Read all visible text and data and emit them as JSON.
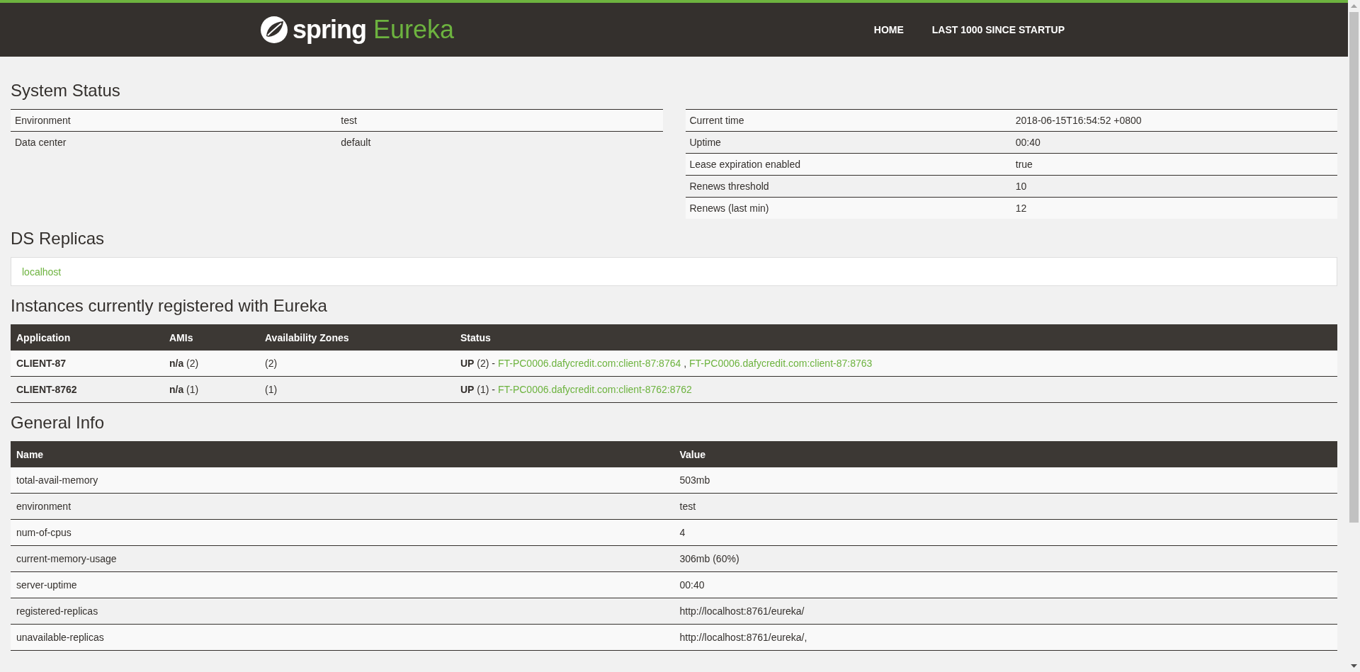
{
  "header": {
    "brand": "spring",
    "product": "Eureka",
    "nav": [
      {
        "label": "HOME"
      },
      {
        "label": "LAST 1000 SINCE STARTUP"
      }
    ]
  },
  "system_status": {
    "title": "System Status",
    "left": [
      {
        "label": "Environment",
        "value": "test"
      },
      {
        "label": "Data center",
        "value": "default"
      }
    ],
    "right": [
      {
        "label": "Current time",
        "value": "2018-06-15T16:54:52 +0800"
      },
      {
        "label": "Uptime",
        "value": "00:40"
      },
      {
        "label": "Lease expiration enabled",
        "value": "true"
      },
      {
        "label": "Renews threshold",
        "value": "10"
      },
      {
        "label": "Renews (last min)",
        "value": "12"
      }
    ]
  },
  "ds_replicas": {
    "title": "DS Replicas",
    "items": [
      "localhost"
    ]
  },
  "instances": {
    "title": "Instances currently registered with Eureka",
    "columns": [
      "Application",
      "AMIs",
      "Availability Zones",
      "Status"
    ],
    "rows": [
      {
        "application": "CLIENT-87",
        "amis": "**n/a** (2)",
        "zones": "(2)",
        "status": [
          {
            "kind": "strong",
            "text": "UP"
          },
          {
            "kind": "text",
            "text": "(2) -"
          },
          {
            "kind": "link",
            "text": "FT-PC0006.dafycredit.com:client-87:8764"
          },
          {
            "kind": "text",
            "text": ","
          },
          {
            "kind": "link",
            "text": "FT-PC0006.dafycredit.com:client-87:8763"
          }
        ]
      },
      {
        "application": "CLIENT-8762",
        "amis": "**n/a** (1)",
        "zones": "(1)",
        "status": [
          {
            "kind": "strong",
            "text": "UP"
          },
          {
            "kind": "text",
            "text": "(1) -"
          },
          {
            "kind": "link",
            "text": "FT-PC0006.dafycredit.com:client-8762:8762"
          }
        ]
      }
    ]
  },
  "general_info": {
    "title": "General Info",
    "columns": [
      "Name",
      "Value"
    ],
    "rows": [
      {
        "name": "total-avail-memory",
        "value": "503mb"
      },
      {
        "name": "environment",
        "value": "test"
      },
      {
        "name": "num-of-cpus",
        "value": "4"
      },
      {
        "name": "current-memory-usage",
        "value": "306mb (60%)"
      },
      {
        "name": "server-uptime",
        "value": "00:40"
      },
      {
        "name": "registered-replicas",
        "value": "http://localhost:8761/eureka/"
      },
      {
        "name": "unavailable-replicas",
        "value": "http://localhost:8761/eureka/,"
      }
    ]
  }
}
